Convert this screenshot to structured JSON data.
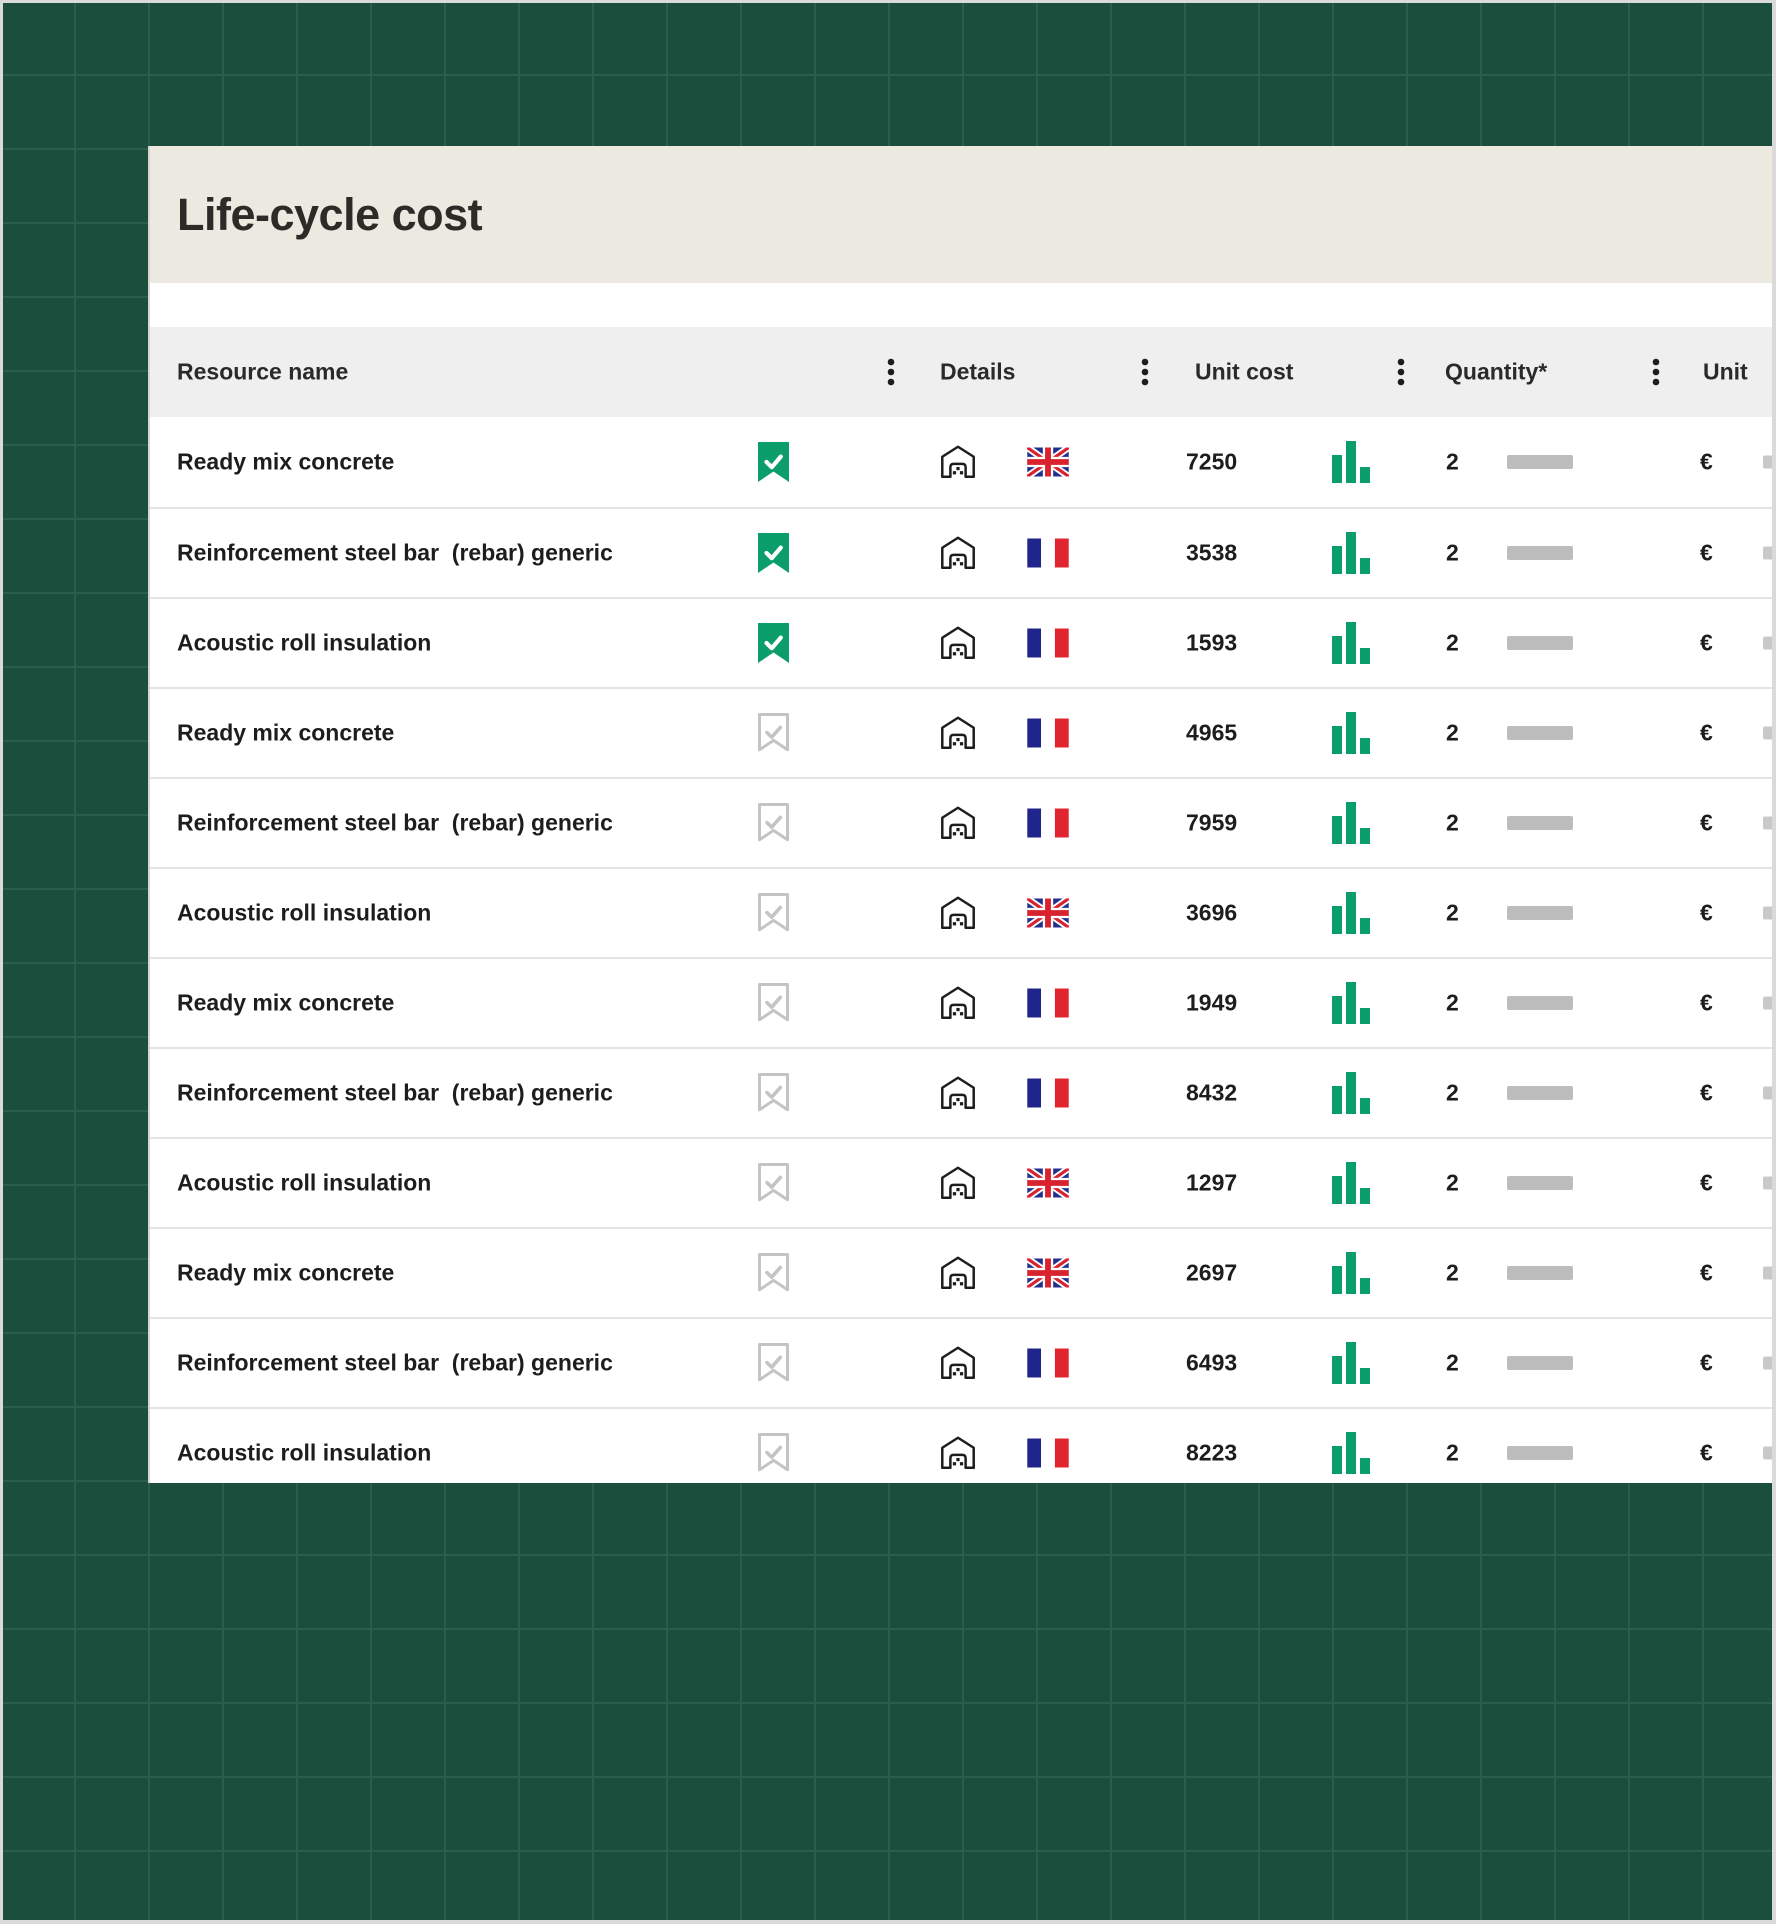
{
  "panel": {
    "title": "Life-cycle cost"
  },
  "table": {
    "columns": [
      "Resource name",
      "Details",
      "Unit cost",
      "Quantity*",
      "Unit"
    ],
    "rows": [
      {
        "name": "Ready mix concrete",
        "bookmarked": true,
        "country": "GB",
        "unit_cost": "7250",
        "quantity": "2",
        "unit": "€"
      },
      {
        "name": "Reinforcement steel bar  (rebar) generic",
        "bookmarked": true,
        "country": "FR",
        "unit_cost": "3538",
        "quantity": "2",
        "unit": "€"
      },
      {
        "name": "Acoustic roll insulation",
        "bookmarked": true,
        "country": "FR",
        "unit_cost": "1593",
        "quantity": "2",
        "unit": "€"
      },
      {
        "name": "Ready mix concrete",
        "bookmarked": false,
        "country": "FR",
        "unit_cost": "4965",
        "quantity": "2",
        "unit": "€"
      },
      {
        "name": "Reinforcement steel bar  (rebar) generic",
        "bookmarked": false,
        "country": "FR",
        "unit_cost": "7959",
        "quantity": "2",
        "unit": "€"
      },
      {
        "name": "Acoustic roll insulation",
        "bookmarked": false,
        "country": "GB",
        "unit_cost": "3696",
        "quantity": "2",
        "unit": "€"
      },
      {
        "name": "Ready mix concrete",
        "bookmarked": false,
        "country": "FR",
        "unit_cost": "1949",
        "quantity": "2",
        "unit": "€"
      },
      {
        "name": "Reinforcement steel bar  (rebar) generic",
        "bookmarked": false,
        "country": "FR",
        "unit_cost": "8432",
        "quantity": "2",
        "unit": "€"
      },
      {
        "name": "Acoustic roll insulation",
        "bookmarked": false,
        "country": "GB",
        "unit_cost": "1297",
        "quantity": "2",
        "unit": "€"
      },
      {
        "name": "Ready mix concrete",
        "bookmarked": false,
        "country": "GB",
        "unit_cost": "2697",
        "quantity": "2",
        "unit": "€"
      },
      {
        "name": "Reinforcement steel bar  (rebar) generic",
        "bookmarked": false,
        "country": "FR",
        "unit_cost": "6493",
        "quantity": "2",
        "unit": "€"
      },
      {
        "name": "Acoustic roll insulation",
        "bookmarked": false,
        "country": "FR",
        "unit_cost": "8223",
        "quantity": "2",
        "unit": "€"
      }
    ]
  },
  "icons": {
    "column_menu": "kebab-menu",
    "bookmark_checked": "bookmark-check-filled",
    "bookmark_unchecked": "bookmark-check-outline",
    "details_building": "warehouse",
    "unit_cost_chart": "bar-chart",
    "flags": [
      "GB",
      "FR"
    ]
  },
  "colors": {
    "background_green": "#1B4E3D",
    "grid_line_green": "#2D5D4B",
    "accent_green": "#0B9E6B",
    "title_band_beige": "#ECE9E1",
    "header_row_gray": "#EFEFF0",
    "skeleton_gray": "#BDBDBD"
  }
}
